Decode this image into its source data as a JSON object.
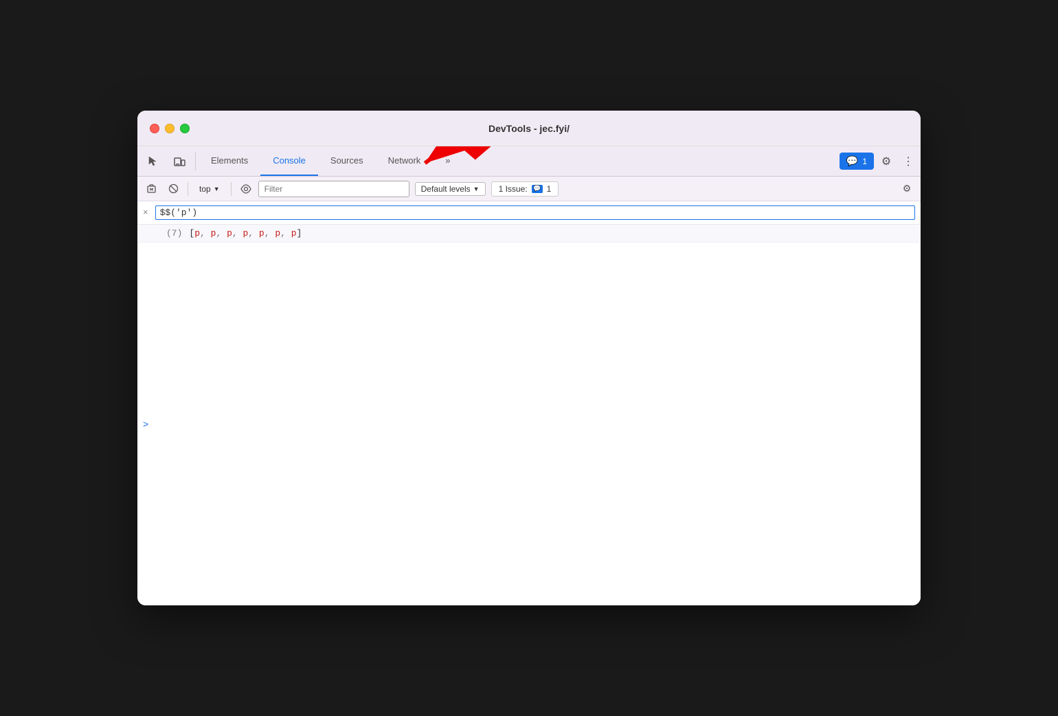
{
  "window": {
    "title": "DevTools - jec.fyi/"
  },
  "titlebar": {
    "buttons": {
      "close": "close",
      "minimize": "minimize",
      "maximize": "maximize"
    }
  },
  "toolbar": {
    "inspect_label": "Inspect element",
    "device_label": "Device toolbar",
    "tabs": [
      {
        "id": "elements",
        "label": "Elements",
        "active": false
      },
      {
        "id": "console",
        "label": "Console",
        "active": true
      },
      {
        "id": "sources",
        "label": "Sources",
        "active": false
      },
      {
        "id": "network",
        "label": "Network",
        "active": false
      },
      {
        "id": "more",
        "label": "»",
        "active": false
      }
    ],
    "badge": {
      "count": "1",
      "label": "1"
    },
    "gear_label": "Settings",
    "more_label": "⋮"
  },
  "console_toolbar": {
    "clear_label": "Clear console",
    "block_label": "Block network requests",
    "context_label": "top",
    "eye_label": "Live expressions",
    "filter_placeholder": "Filter",
    "levels_label": "Default levels",
    "issue_label": "1 Issue:",
    "issue_count": "1",
    "settings_label": "Console settings"
  },
  "console": {
    "input_value": "$$('p')",
    "clear_x": "×",
    "result_count": "(7)",
    "result_items": [
      "p",
      "p",
      "p",
      "p",
      "p",
      "p",
      "p"
    ],
    "prompt_chevron": ">"
  }
}
